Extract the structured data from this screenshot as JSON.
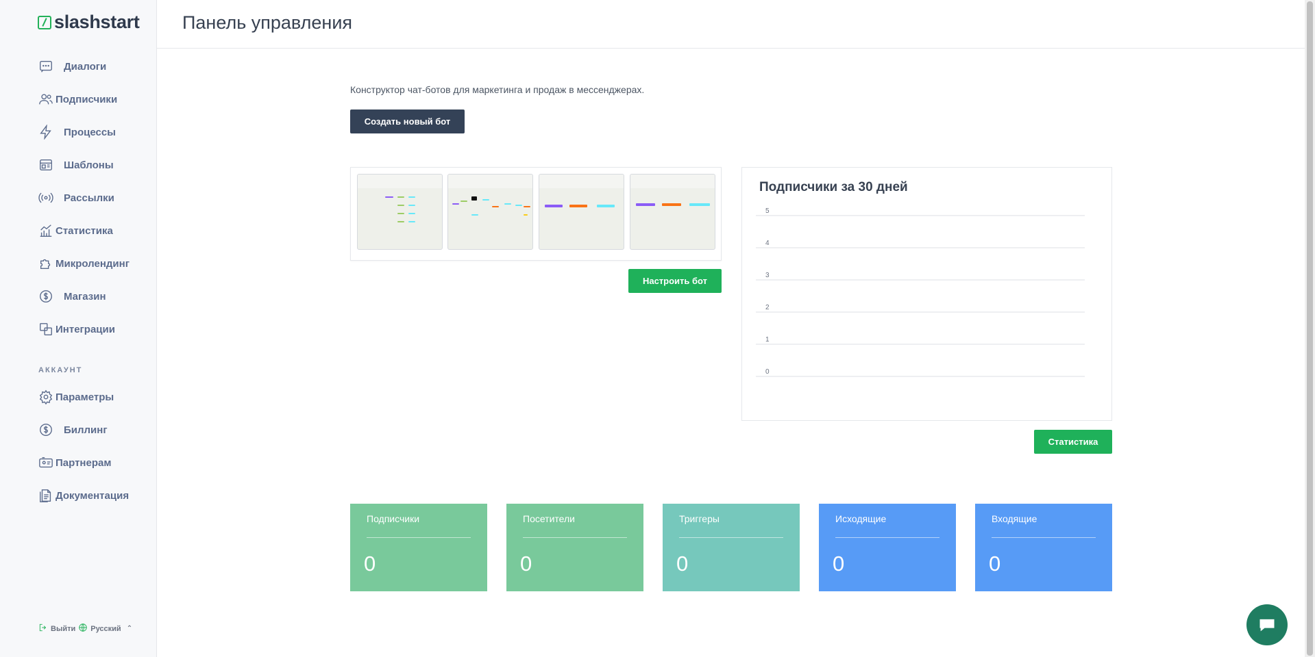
{
  "brand": {
    "name": "slashstart",
    "accent": "#22b158"
  },
  "sidebar": {
    "items": [
      {
        "label": "Диалоги",
        "icon": "chat-icon"
      },
      {
        "label": "Подписчики",
        "icon": "users-icon"
      },
      {
        "label": "Процессы",
        "icon": "bolt-icon"
      },
      {
        "label": "Шаблоны",
        "icon": "template-icon"
      },
      {
        "label": "Рассылки",
        "icon": "broadcast-icon"
      },
      {
        "label": "Статистика",
        "icon": "chart-icon"
      },
      {
        "label": "Микролендинг",
        "icon": "puzzle-icon"
      },
      {
        "label": "Магазин",
        "icon": "dollar-icon"
      },
      {
        "label": "Интеграции",
        "icon": "integration-icon"
      }
    ],
    "account_title": "АККАУНТ",
    "account_items": [
      {
        "label": "Параметры",
        "icon": "gear-icon"
      },
      {
        "label": "Биллинг",
        "icon": "dollar-icon"
      },
      {
        "label": "Партнерам",
        "icon": "partner-icon"
      },
      {
        "label": "Документация",
        "icon": "document-icon"
      }
    ],
    "footer": {
      "logout": "Выйти",
      "language": "Русский"
    }
  },
  "header": {
    "title": "Панель управления"
  },
  "main": {
    "intro": "Конструктор чат-ботов для маркетинга и продаж в мессенджерах.",
    "create_bot": "Создать новый бот",
    "configure_bot": "Настроить бот",
    "statistics_button": "Статистика"
  },
  "chart_data": {
    "type": "line",
    "title": "Подписчики за 30 дней",
    "yticks": [
      0,
      1,
      2,
      3,
      4,
      5
    ],
    "ylim": [
      0,
      5
    ],
    "series": [],
    "grid": true
  },
  "stats": [
    {
      "label": "Подписчики",
      "value": "0",
      "color": "#79c99b"
    },
    {
      "label": "Посетители",
      "value": "0",
      "color": "#79c99b"
    },
    {
      "label": "Триггеры",
      "value": "0",
      "color": "#76c8bc"
    },
    {
      "label": "Исходящие",
      "value": "0",
      "color": "#579bf6"
    },
    {
      "label": "Входящие",
      "value": "0",
      "color": "#579bf6"
    }
  ]
}
